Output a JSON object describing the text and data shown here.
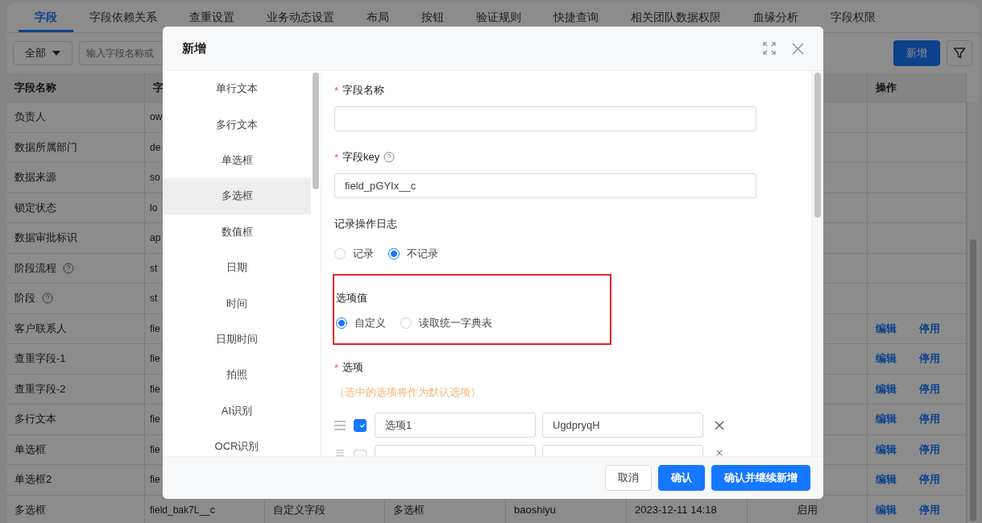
{
  "tabs": [
    {
      "label": "字段",
      "selected": true
    },
    {
      "label": "字段依赖关系",
      "selected": false
    },
    {
      "label": "查重设置",
      "selected": false
    },
    {
      "label": "业务动态设置",
      "selected": false
    },
    {
      "label": "布局",
      "selected": false
    },
    {
      "label": "按钮",
      "selected": false
    },
    {
      "label": "验证规则",
      "selected": false
    },
    {
      "label": "快捷查询",
      "selected": false
    },
    {
      "label": "相关团队数据权限",
      "selected": false
    },
    {
      "label": "血缘分析",
      "selected": false
    },
    {
      "label": "字段权限",
      "selected": false
    }
  ],
  "toolbar": {
    "filter_dropdown": "全部",
    "search": {
      "placeholder": "输入字段名称或"
    },
    "add_button": "新增"
  },
  "table": {
    "header": {
      "column_1": "字段名称",
      "column_2": "字",
      "column_8": "操作"
    },
    "rows": [
      {
        "name": "负责人",
        "help": false,
        "column_2": "ow"
      },
      {
        "name": "数据所属部门",
        "help": false,
        "column_2": "de"
      },
      {
        "name": "数据来源",
        "help": false,
        "column_2": "so"
      },
      {
        "name": "锁定状态",
        "help": false,
        "column_2": "lo"
      },
      {
        "name": "数据审批标识",
        "help": false,
        "column_2": "ap"
      },
      {
        "name": "阶段流程",
        "help": true,
        "column_2": "st"
      },
      {
        "name": "阶段",
        "help": true,
        "column_2": "st"
      },
      {
        "name": "客户联系人",
        "help": false,
        "column_2": "fie",
        "actions": [
          "编辑",
          "停用"
        ]
      },
      {
        "name": "查重字段-1",
        "help": false,
        "column_2": "fie",
        "actions": [
          "编辑",
          "停用"
        ]
      },
      {
        "name": "查重字段-2",
        "help": false,
        "column_2": "fie",
        "actions": [
          "编辑",
          "停用"
        ]
      },
      {
        "name": "多行文本",
        "help": false,
        "column_2": "fie",
        "actions": [
          "编辑",
          "停用"
        ]
      },
      {
        "name": "单选框",
        "help": false,
        "column_2": "fie",
        "actions": [
          "编辑",
          "停用"
        ]
      },
      {
        "name": "单选框2",
        "help": false,
        "column_2": "fie",
        "actions": [
          "编辑",
          "停用"
        ]
      },
      {
        "name": "多选框",
        "help": false,
        "column_2": "field_bak7L__c",
        "column_3": "自定义字段",
        "column_4": "多选框",
        "column_5": "baoshiyu",
        "column_6": "2023-12-11 14:18",
        "column_7": "启用",
        "actions": [
          "编辑",
          "停用"
        ]
      }
    ]
  },
  "modal": {
    "title": "新增",
    "field_types": [
      {
        "label": "单行文本",
        "selected": false
      },
      {
        "label": "多行文本",
        "selected": false
      },
      {
        "label": "单选框",
        "selected": false
      },
      {
        "label": "多选框",
        "selected": true
      },
      {
        "label": "数值框",
        "selected": false
      },
      {
        "label": "日期",
        "selected": false
      },
      {
        "label": "时间",
        "selected": false
      },
      {
        "label": "日期时间",
        "selected": false
      },
      {
        "label": "拍照",
        "selected": false
      },
      {
        "label": "AI识别",
        "selected": false
      },
      {
        "label": "OCR识别",
        "selected": false
      }
    ],
    "name_field": {
      "label": "字段名称",
      "required_mark": "*"
    },
    "key_field": {
      "label": "字段key",
      "required_mark": "*",
      "help": true,
      "value": "field_pGYIx__c"
    },
    "log": {
      "label": "记录操作日志",
      "options": [
        {
          "label": "记录",
          "selected": false
        },
        {
          "label": "不记录",
          "selected": true
        }
      ]
    },
    "option_source": {
      "label": "选项值",
      "highlighted": true,
      "options": [
        {
          "label": "自定义",
          "selected": true
        },
        {
          "label": "读取统一字典表",
          "selected": false
        }
      ]
    },
    "options": {
      "label": "选项",
      "required_mark": "*",
      "hint": "（选中的选项将作为默认选项）",
      "items": [
        {
          "checked": true,
          "label": "选项1",
          "value": "UgdpryqH"
        },
        {
          "checked": false
        }
      ]
    },
    "buttons": [
      {
        "label": "取消",
        "kind": "default"
      },
      {
        "label": "确认",
        "kind": "primary"
      },
      {
        "label": "确认并继续新增",
        "kind": "primary"
      }
    ]
  }
}
